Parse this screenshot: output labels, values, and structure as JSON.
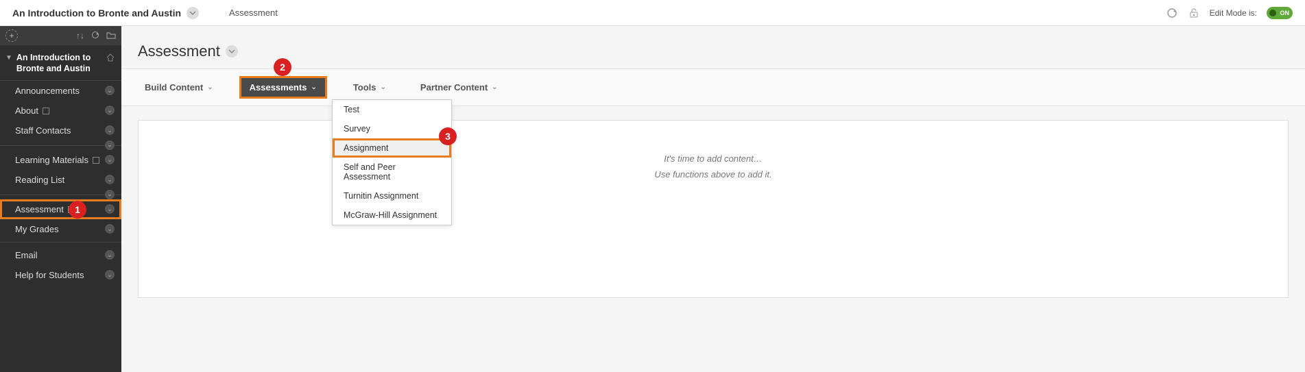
{
  "header": {
    "course_title": "An Introduction to Bronte and Austin",
    "breadcrumb": "Assessment",
    "edit_mode_label": "Edit Mode is:",
    "toggle_text": "ON"
  },
  "sidebar": {
    "course_title": "An Introduction to Bronte and Austin",
    "items": [
      {
        "label": "Announcements",
        "square": false
      },
      {
        "label": "About",
        "square": true
      },
      {
        "label": "Staff Contacts",
        "square": false
      },
      {
        "divider": true
      },
      {
        "label": "Learning Materials",
        "square": true
      },
      {
        "label": "Reading List",
        "square": false
      },
      {
        "divider": true
      },
      {
        "label": "Assessment",
        "square": true,
        "highlight": true
      },
      {
        "label": "My Grades",
        "square": false
      },
      {
        "divider": false,
        "plain_divider": true
      },
      {
        "label": "Email",
        "square": false
      },
      {
        "label": "Help for Students",
        "square": false
      }
    ]
  },
  "page": {
    "title": "Assessment"
  },
  "actionbar": {
    "build_content": "Build Content",
    "assessments": "Assessments",
    "tools": "Tools",
    "partner_content": "Partner Content"
  },
  "dropdown": {
    "items": [
      {
        "label": "Test"
      },
      {
        "label": "Survey"
      },
      {
        "label": "Assignment",
        "highlight": true
      },
      {
        "label": "Self and Peer Assessment"
      },
      {
        "label": "Turnitin Assignment"
      },
      {
        "label": "McGraw-Hill Assignment"
      }
    ]
  },
  "content": {
    "line1": "It's time to add content…",
    "line2": "Use functions above to add it."
  },
  "badges": {
    "b1": "1",
    "b2": "2",
    "b3": "3"
  }
}
